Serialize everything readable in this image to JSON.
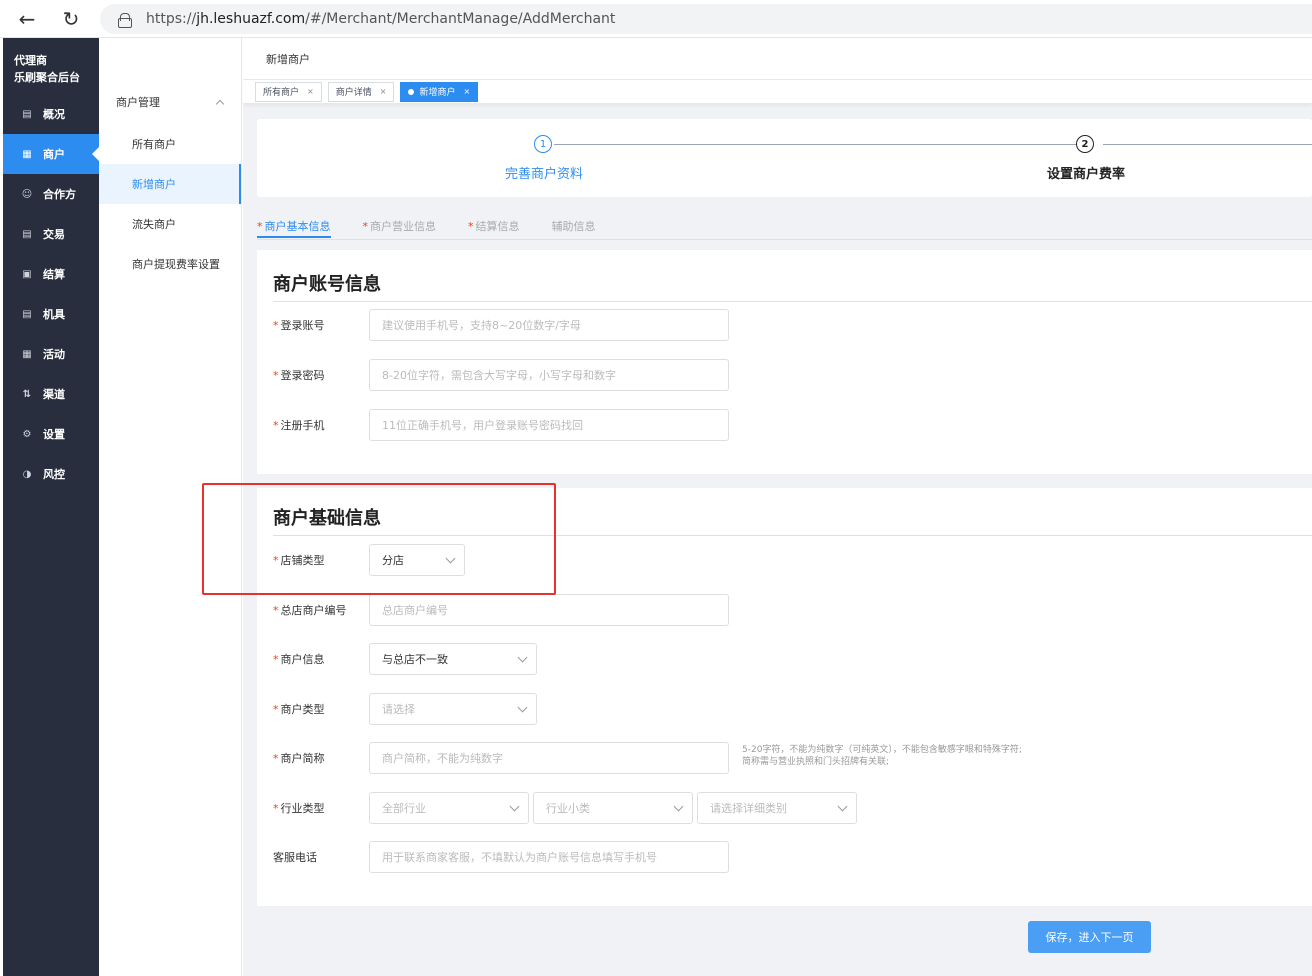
{
  "browser": {
    "url_prefix": "https://",
    "url_host": "jh.leshuazf.com",
    "url_path": "/#/Merchant/MerchantManage/AddMerchant"
  },
  "sidebar": {
    "brand_line1": "代理商",
    "brand_line2": "乐刷聚合后台",
    "items": [
      {
        "label": "概况",
        "icon": "monitor-icon"
      },
      {
        "label": "商户",
        "icon": "store-icon"
      },
      {
        "label": "合作方",
        "icon": "partner-icon"
      },
      {
        "label": "交易",
        "icon": "trade-icon"
      },
      {
        "label": "结算",
        "icon": "settle-icon"
      },
      {
        "label": "机具",
        "icon": "device-icon"
      },
      {
        "label": "活动",
        "icon": "grid-icon"
      },
      {
        "label": "渠道",
        "icon": "channel-icon"
      },
      {
        "label": "设置",
        "icon": "gear-icon"
      },
      {
        "label": "风控",
        "icon": "shield-icon"
      }
    ]
  },
  "subside": {
    "group": "商户管理",
    "items": [
      "所有商户",
      "新增商户",
      "流失商户",
      "商户提现费率设置"
    ]
  },
  "header": {
    "title": "新增商户"
  },
  "tabs": [
    {
      "label": "所有商户"
    },
    {
      "label": "商户详情"
    },
    {
      "label": "新增商户"
    }
  ],
  "steps": [
    {
      "num": "1",
      "label": "完善商户资料"
    },
    {
      "num": "2",
      "label": "设置商户费率"
    }
  ],
  "form_tabs": [
    "商户基本信息",
    "商户营业信息",
    "结算信息",
    "辅助信息"
  ],
  "account": {
    "title": "商户账号信息",
    "fields": [
      {
        "label": "登录账号",
        "placeholder": "建议使用手机号，支持8~20位数字/字母"
      },
      {
        "label": "登录密码",
        "placeholder": "8-20位字符，需包含大写字母，小写字母和数字"
      },
      {
        "label": "注册手机",
        "placeholder": "11位正确手机号，用户登录账号密码找回"
      }
    ]
  },
  "basic": {
    "title": "商户基础信息",
    "store_type": {
      "label": "店铺类型",
      "value": "分店"
    },
    "hq_no": {
      "label": "总店商户编号",
      "placeholder": "总店商户编号"
    },
    "merchant_info": {
      "label": "商户信息",
      "value": "与总店不一致"
    },
    "merchant_type": {
      "label": "商户类型",
      "placeholder": "请选择"
    },
    "short_name": {
      "label": "商户简称",
      "placeholder": "商户简称，不能为纯数字",
      "hint1": "5-20字符，不能为纯数字（可纯英文），不能包含敏感字眼和特殊字符;",
      "hint2": "简称需与营业执照和门头招牌有关联;"
    },
    "industry": {
      "label": "行业类型",
      "select1": "全部行业",
      "select2": "行业小类",
      "select3": "请选择详细类别"
    },
    "service_phone": {
      "label": "客服电话",
      "placeholder": "用于联系商家客服，不填默认为商户账号信息填写手机号"
    }
  },
  "save_button": "保存，进入下一页",
  "colors": {
    "primary": "#2d8cf0",
    "sidebar_bg": "#282e3e",
    "required": "#ed4014",
    "highlight": "#e5322d"
  }
}
